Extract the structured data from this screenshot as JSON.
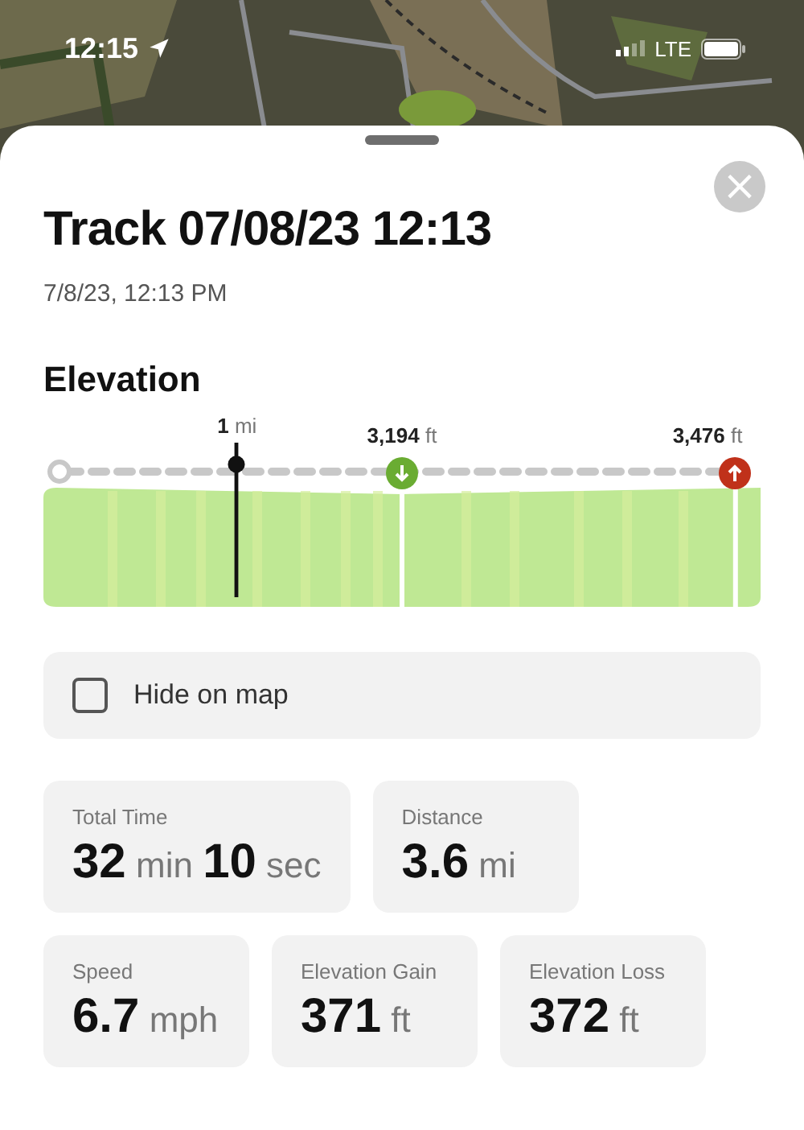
{
  "status_bar": {
    "time": "12:15",
    "network": "LTE"
  },
  "sheet": {
    "title": "Track 07/08/23 12:13",
    "subtitle": "7/8/23, 12:13 PM",
    "close_icon": "×"
  },
  "elevation": {
    "heading": "Elevation",
    "markers": [
      {
        "kind": "cursor",
        "label": "**1** mi"
      },
      {
        "kind": "low",
        "label": "**3,194** ft"
      },
      {
        "kind": "high",
        "label": "**3,476** ft"
      }
    ]
  },
  "hide_on_map": {
    "label": "Hide on map",
    "checked": false
  },
  "stats": [
    [
      {
        "label": "Total Time",
        "value": "**32** min **10** sec"
      },
      {
        "label": "Distance",
        "value": "**3.6** mi"
      }
    ],
    [
      {
        "label": "Speed",
        "value": "**6.7** mph"
      },
      {
        "label": "Elevation Gain",
        "value": "**371** ft"
      },
      {
        "label": "Elevation Loss",
        "value": "**372** ft"
      }
    ]
  ]
}
